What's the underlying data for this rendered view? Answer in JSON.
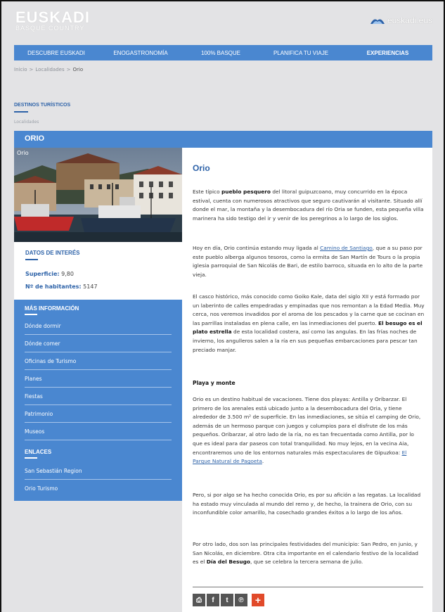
{
  "header": {
    "logo_title": "EUSKADI",
    "logo_subtitle": "BASQUE COUNTRY",
    "brand": "euskadi.eus"
  },
  "nav": {
    "items": [
      {
        "label": "DESCUBRE EUSKADI",
        "bold": false
      },
      {
        "label": "ENOGASTRONOMÍA",
        "bold": false
      },
      {
        "label": "100% BASQUE",
        "bold": false
      },
      {
        "label": "PLANIFICA TU VIAJE",
        "bold": false
      },
      {
        "label": "EXPERIENCIAS",
        "bold": true
      }
    ]
  },
  "breadcrumb": {
    "items": [
      "Inicio",
      "Localidades",
      "Orio"
    ]
  },
  "section": {
    "label": "DESTINOS TURÍSTICOS",
    "small_link": "Localidades"
  },
  "place": {
    "name": "ORIO",
    "photo_caption": "Orio"
  },
  "info": {
    "title": "DATOS DE INTERÉS",
    "surface_label": "Superficie:",
    "surface_value": "9,80",
    "inhabitants_label": "Nº de habitantes:",
    "inhabitants_value": "5147"
  },
  "more_info": {
    "title": "MÁS INFORMACIÓN",
    "items": [
      "Dónde dormir",
      "Dónde comer",
      "Oficinas de Turismo",
      "Planes",
      "Fiestas",
      "Patrimonio",
      "Museos"
    ]
  },
  "links": {
    "title": "ENLACES",
    "items": [
      "San Sebastián Region",
      "Orio Turismo"
    ]
  },
  "article": {
    "title": "Orio",
    "p1_a": "Este típico ",
    "p1_b": "pueblo pesquero",
    "p1_c": " del litoral guipuzcoano, muy concurrido en la época estival, cuenta con numerosos atractivos que seguro cautivarán al visitante. Situado allí donde el mar, la montaña y la desembocadura del río Oria se funden, esta pequeña villa marinera ha sido testigo del ir y venir de los peregrinos a lo largo de los siglos.",
    "p2_a": "Hoy en día, Orio continúa estando muy ligada al ",
    "p2_link": "Camino de Santiago",
    "p2_b": ", que a su paso por este pueblo alberga algunos tesoros, como la ermita de San Martín de Tours o la propia iglesia parroquial de San Nicolás de Bari, de estilo barroco, situada en lo alto de la parte vieja.",
    "p3_a": "El casco histórico, más conocido como Goiko Kale, data del siglo XII y está formado por un laberinto de calles empedradas y empinadas que nos remontan a la Edad Media. Muy cerca, nos veremos invadidos por el aroma de los pescados y la carne que se cocinan en las parrillas instaladas en plena calle, en las inmediaciones del puerto. ",
    "p3_b": "El besugo es el plato estrella",
    "p3_c": " de esta localidad costera, así como las angulas. En las frías noches de invierno, los angulleros salen a la ría en sus pequeñas embarcaciones para pescar tan preciado manjar.",
    "subhead": "Playa y monte",
    "p4_a": "Orio es un destino habitual de vacaciones. Tiene dos playas: Antilla y Oribarzar. El primero de los arenales está ubicado junto a la desembocadura del Oria, y tiene alrededor de 3.500 m² de superficie. En las inmediaciones, se sitúa el camping de Orio, además de un hermoso parque con juegos y columpios para el disfrute de los más pequeños. Oribarzar, al otro lado de la ría, no es tan frecuentada como Antilla, por lo que es ideal para dar paseos con total tranquilidad. No muy lejos, en la vecina Aia, encontraremos uno de los entornos naturales más espectaculares de Gipuzkoa: ",
    "p4_link": "El Parque Natural de Pagoeta",
    "p4_b": ".",
    "p5": "Pero, si por algo se ha hecho conocida Orio, es por su afición a las regatas. La localidad ha estado muy vinculada al mundo del remo y, de hecho, la trainera de Orio, con su inconfundible color amarillo, ha cosechado grandes éxitos a lo largo de los años.",
    "p6_a": "Por otro lado, dos son las principales festividades del municipio: San Pedro, en junio, y San Nicolás, en diciembre. Otra cita importante en el calendario festivo de la localidad es el ",
    "p6_b": "Día del Besugo",
    "p6_c": ", que se celebra la tercera semana de julio."
  },
  "share": {
    "print": "⎙",
    "facebook": "f",
    "twitter": "t",
    "pinterest": "℗",
    "more": "+"
  },
  "colors": {
    "accent": "#4a87d0",
    "title_blue": "#2d62a8",
    "background": "#e3e3e5",
    "share_plus": "#e14a2a"
  }
}
